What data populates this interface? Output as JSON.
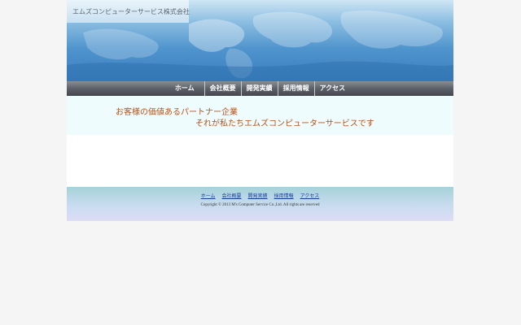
{
  "header": {
    "company_name": "エムズコンピューターサービス株式会社"
  },
  "nav": {
    "items": [
      {
        "label": "ホーム"
      },
      {
        "label": "会社概要"
      },
      {
        "label": "開発実績"
      },
      {
        "label": "採用情報"
      },
      {
        "label": "アクセス"
      }
    ]
  },
  "tagline": {
    "line1": "お客様の価値あるパートナー企業",
    "line2": "それが私たちエムズコンピューターサービスです"
  },
  "footer": {
    "links": [
      {
        "label": "ホーム"
      },
      {
        "label": "会社概要"
      },
      {
        "label": "開発実績"
      },
      {
        "label": "採用情報"
      },
      {
        "label": "アクセス"
      }
    ],
    "copyright": "Copyright © 2013 M's Computer Service Co.,Ltd. All rights are reserved"
  },
  "colors": {
    "tagline_text": "#b4531e",
    "footer_link": "#1a3f9c"
  }
}
